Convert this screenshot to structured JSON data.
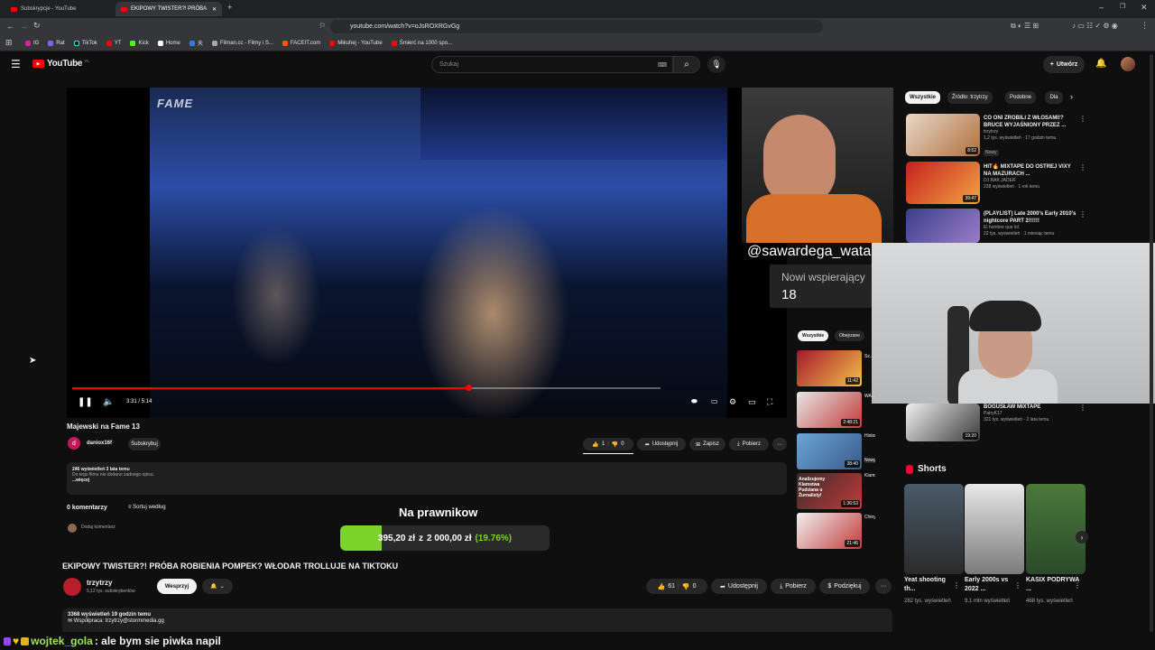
{
  "browser": {
    "tabs": [
      {
        "label": "Subskrypcje - YouTube",
        "active": false
      },
      {
        "label": "EKIPOWY TWISTER?! PRÓBA",
        "active": true
      }
    ],
    "url": "youtube.com/watch?v=oJsROXRGvGg",
    "bookmarks": [
      "IG",
      "Rat",
      "TikTok",
      "YT",
      "Kick",
      "Home",
      "天",
      "Filman.cc - Filmy i S...",
      "FACEIT.com",
      "Mikuhej - YouTube",
      "Śmierć na 1000 spo..."
    ]
  },
  "youtube": {
    "logo": "YouTube",
    "region": "PL",
    "search_placeholder": "Szukaj",
    "create_label": "Utwórz"
  },
  "player": {
    "overlay_logo": "FAME",
    "time": "3:31 / 5:14",
    "progress_fraction": 0.673
  },
  "stream_overlay": {
    "handle": "@sawardega_watak",
    "supporters_label": "Nowi wspierający",
    "supporters_count": "18"
  },
  "video": {
    "title": "Majewski na Fame 13",
    "channel": "daniox16f",
    "channel_initial": "d",
    "subscribe": "Subskrybuj",
    "likes": "1",
    "dislikes": "0",
    "share": "Udostępnij",
    "save": "Zapisz",
    "download": "Pobierz",
    "views_date": "246 wyświetleń  3 lata temu",
    "description": "Do tego filmu nie dodano żadnego opisu.",
    "more": "...więcej",
    "comments_count": "0 komentarzy",
    "sort_label": "Sortuj według",
    "add_comment": "Dodaj komentarz"
  },
  "donation_goal": {
    "title": "Na prawnikow",
    "current": "395,20 zł",
    "separator": "z",
    "target": "2 000,00 zł",
    "percent_label": "(19.76%)",
    "fraction": 0.1976
  },
  "background_video": {
    "title": "EKIPOWY TWISTER?! PRÓBA ROBIENIA POMPEK? WŁODAR TROLLUJE NA TIKTOKU",
    "channel": "trzytrzy",
    "subs": "5,12 tys. subskrybentów",
    "join": "Wesprzyj",
    "likes": "61",
    "dislikes": "0",
    "share": "Udostępnij",
    "download": "Pobierz",
    "thanks": "Podziękuj",
    "views_date": "3368 wyświetleń  19 godzin temu",
    "collab": "Współpraca: trzytrzy@stormmedia.gg"
  },
  "chat": {
    "user": "wojtek_gola",
    "message": ": ale bym sie piwka napil"
  },
  "sidebar": {
    "chips": [
      "Wszystkie",
      "Źródło: trzytrzy",
      "Podobne",
      "Dla"
    ],
    "videos": [
      {
        "title": "CO ONI ZROBILI Z WŁOSAMI!? BRUCE WYJAŚNIONY PRZEZ ...",
        "channel": "trzytrzy",
        "meta": "1,2 tys. wyświetleń · 17 godzin temu",
        "badge": "Nowy",
        "duration": "8:52"
      },
      {
        "title": "HIT🔥 MIXTAPE DO OSTREJ VIXY NA MAZURACH ...",
        "channel": "DJ RAK JADER",
        "meta": "228 wyświetleń · 1 rok temu",
        "duration": "39:47"
      },
      {
        "title": "(PLAYLIST) Late 2000's Early 2010's nightcore PART 2!!!!!!",
        "channel": "El hombre que lol",
        "meta": "22 tys. wyświetleń · 1 miesiąc temu",
        "duration": ""
      },
      {
        "title": "BOGUSŁAW MIXTAPE",
        "channel": "PatryK17",
        "meta": "321 tys. wyświetleń · 2 lata temu",
        "duration": "19:20"
      }
    ],
    "shorts_title": "Shorts",
    "shorts": [
      {
        "title": "Yeat shooting th...",
        "views": "282 tys. wyświetleń"
      },
      {
        "title": "Early 2000s vs 2022 ...",
        "views": "9,1 mln wyświetleń"
      },
      {
        "title": "KASIX PODRYWA ...",
        "views": "468 tys. wyświetleń"
      }
    ]
  },
  "mini_list": {
    "chips": [
      "Wszystkie",
      "Obejrzane"
    ],
    "durations": [
      "11:42",
      "2:48:21",
      "38:40",
      "1:36:53",
      "21:46"
    ],
    "badge": "Nowy",
    "titles": [
      "Sz...",
      "WA... STANOWI...",
      "Historia Sol...",
      "Klamstwa F... Fakty, o kto...",
      "Chiny żyją w ... Global Sou..."
    ],
    "thumb_captions": [
      "Analizujemy Klamstwa Pudziana u Żurnalisty!"
    ]
  }
}
